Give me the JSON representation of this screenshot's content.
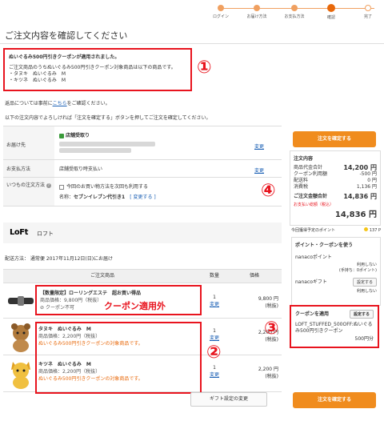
{
  "steps": [
    {
      "label": "ログイン"
    },
    {
      "label": "お届け方法"
    },
    {
      "label": "お支払方法"
    },
    {
      "label": "確認"
    },
    {
      "label": "完了"
    }
  ],
  "page_title": "ご注文内容を確認してください",
  "notice": {
    "heading": "ぬいぐるみ500円引きクーポンが適用されました。",
    "line1": "ご注文商品のうちぬいぐるみ500円引きクーポン対象商品は以下の商品です。",
    "item1": "・タヌキ　ぬいぐるみ　M",
    "item2": "・キツネ　ぬいぐるみ　M"
  },
  "annotations": {
    "n1": "①",
    "n2": "②",
    "n3": "③",
    "n4": "④",
    "coupon_na": "クーポン適用外"
  },
  "para1": {
    "before": "返品については事前に",
    "link": "こちら",
    "after": "をご確認ください。"
  },
  "para2": "以下の注文内容でよろしければ「注文を確定する」ボタンを押してご注文を確定してください。",
  "info": {
    "store_pickup": "店舗受取り",
    "rows": [
      {
        "key": "お届け先",
        "value": "",
        "edit": "変更"
      },
      {
        "key": "お支払方法",
        "value": "店舗受取り時支払い",
        "edit": "変更"
      },
      {
        "key": "いつもの注文方法",
        "value": "今回のお買い物方法を次回も利用する",
        "edit": ""
      }
    ],
    "name_label": "名称：",
    "name_value": "セブンイレブン代引き1",
    "name_edit": "[ 変更する ]"
  },
  "shop": {
    "logo": "LoFt",
    "name": "ロフト"
  },
  "delivery_date": "配送方法： 通常便 2017年11月12日(日)にお届け",
  "prod_header": {
    "item": "ご注文商品",
    "qty": "数量",
    "price": "価格"
  },
  "products": [
    {
      "name": "【数量限定】ローリングエステ　超お買い得品",
      "price": "商品価格：9,800円",
      "tax": "（税抜）",
      "coupon": "クーポン不可",
      "qty": "1",
      "qty_edit": "変更",
      "total": "9,800 円",
      "total_tax": "(税抜)"
    },
    {
      "name": "タヌキ　ぬいぐるみ　M",
      "price": "商品価格：2,200円",
      "tax": "（税抜）",
      "coupon": "ぬいぐるみ500円引きクーポンの対象商品です。",
      "qty": "1",
      "qty_edit": "変更",
      "total": "2,200 円",
      "total_tax": "(税抜)"
    },
    {
      "name": "キツネ　ぬいぐるみ　M",
      "price": "商品価格：2,200円",
      "tax": "（税抜）",
      "coupon": "ぬいぐるみ500円引きクーポンの対象商品です。",
      "qty": "1",
      "qty_edit": "変更",
      "total": "2,200 円",
      "total_tax": "(税抜)"
    }
  ],
  "gift_button": "ギフト設定の変更",
  "order_button": "注文を確定する",
  "summary": {
    "title": "注文内容",
    "rows": [
      {
        "k": "商品代金合計",
        "v": "14,200 円"
      },
      {
        "k": "クーポン利用額",
        "v": "-500 円"
      },
      {
        "k": "配送料",
        "v": "0 円"
      },
      {
        "k": "消費税",
        "v": "1,136 円"
      }
    ],
    "total_label": "ご注文金額合計",
    "total_value": "14,836 円",
    "pay_label": "お支払い総額（税込）",
    "pay_value": "14,836 円"
  },
  "points": {
    "earn_label": "今回獲得予定のポイント",
    "earn_value": "137 P",
    "title": "ポイント・クーポンを使う",
    "nanaco_point": "nanacoポイント",
    "not_use": "利用しない",
    "holding": "(手持ち：0ポイント)",
    "nanaco_gift": "nanacoギフト",
    "set": "設定する"
  },
  "coupon": {
    "title": "クーポンを適用",
    "set": "設定する",
    "code": "LOFT_STUFFED_500OFF:ぬいぐるみ500円引きクーポン",
    "amount": "500円分"
  },
  "colors": {
    "accent": "#f08c1e",
    "annotation": "#e8141e",
    "link": "#1a5fb4"
  }
}
